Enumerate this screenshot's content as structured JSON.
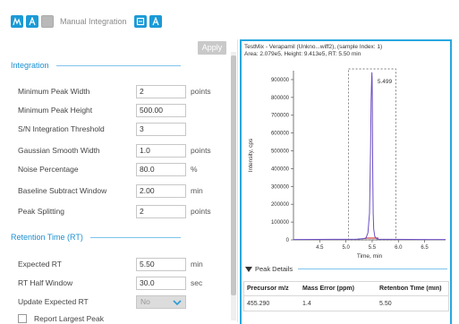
{
  "toolbar": {
    "title": "Manual Integration"
  },
  "apply_label": "Apply",
  "integration": {
    "header": "Integration",
    "fields": [
      {
        "label": "Minimum Peak Width",
        "value": "2",
        "unit": "points"
      },
      {
        "label": "Minimum Peak Height",
        "value": "500.00",
        "unit": ""
      },
      {
        "label": "S/N Integration Threshold",
        "value": "3",
        "unit": ""
      },
      {
        "label": "Gaussian Smooth Width",
        "value": "1.0",
        "unit": "points"
      },
      {
        "label": "Noise Percentage",
        "value": "80.0",
        "unit": "%"
      },
      {
        "label": "Baseline Subtract Window",
        "value": "2.00",
        "unit": "min"
      },
      {
        "label": "Peak Splitting",
        "value": "2",
        "unit": "points"
      }
    ]
  },
  "retention": {
    "header": "Retention Time (RT)",
    "fields": [
      {
        "label": "Expected RT",
        "value": "5.50",
        "unit": "min"
      },
      {
        "label": "RT Half Window",
        "value": "30.0",
        "unit": "sec"
      }
    ],
    "update_label": "Update Expected RT",
    "update_value": "No",
    "report_label": "Report Largest Peak"
  },
  "plot": {
    "title": "TestMix - Verapamil (Unkno...wiff2), (sample Index: 1)",
    "subtitle": "Area: 2.079e5, Height: 9.413e5, RT: 5.50 min",
    "peak_label": "5.499",
    "details_label": "Peak Details"
  },
  "chart_data": {
    "type": "line",
    "xlabel": "Time, min",
    "ylabel": "Intensity, cps",
    "xlim": [
      4.0,
      6.9
    ],
    "ylim": [
      0,
      950000
    ],
    "yticks": [
      0,
      100000,
      200000,
      300000,
      400000,
      500000,
      600000,
      700000,
      800000,
      900000
    ],
    "ytick_labels": [
      "0",
      "100000",
      "200000",
      "300000",
      "400000",
      "500000",
      "600000",
      "700000",
      "800000",
      "900000"
    ],
    "xticks": [
      4.5,
      5.0,
      5.5,
      6.0,
      6.5
    ],
    "xtick_labels": [
      "4.5",
      "5.0",
      "5.5",
      "6.0",
      "6.5"
    ],
    "series": [
      {
        "x": [
          4.0,
          4.4,
          4.8,
          5.2,
          5.38,
          5.42,
          5.45,
          5.47,
          5.48,
          5.49,
          5.495,
          5.5,
          5.505,
          5.51,
          5.52,
          5.53,
          5.55,
          5.58,
          5.62,
          5.8,
          6.2,
          6.6,
          6.9
        ],
        "y": [
          2000,
          2500,
          3000,
          4000,
          8000,
          40000,
          150000,
          520000,
          780000,
          900000,
          941300,
          900000,
          720000,
          420000,
          150000,
          60000,
          20000,
          8000,
          4000,
          3000,
          2500,
          2000,
          2000
        ]
      }
    ],
    "integration_window": [
      5.05,
      5.95
    ],
    "peak_rt": 5.499,
    "colors": {
      "trace": "#6b4fc4",
      "baseline": "#d94040",
      "window": "#555555"
    }
  },
  "table": {
    "headers": [
      "Precursor m/z",
      "Mass Error (ppm)",
      "Retention Time (min)"
    ],
    "rows": [
      [
        "455.290",
        "1.4",
        "5.50"
      ]
    ]
  }
}
